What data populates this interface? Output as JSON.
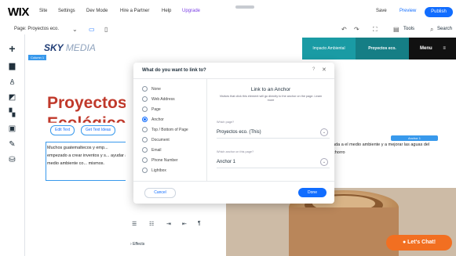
{
  "topbar": {
    "logo": "WIX",
    "menu": [
      "Site",
      "Settings",
      "Dev Mode",
      "Hire a Partner",
      "Help",
      "Upgrade"
    ],
    "save": "Save",
    "preview": "Preview",
    "publish": "Publish"
  },
  "secbar": {
    "page_label": "Page: Proyectos eco.",
    "tools_label": "Tools",
    "search_label": "Search"
  },
  "site": {
    "logo_main": "SKY",
    "logo_sub": "MEDIA",
    "nav": [
      "Impacto Ambiental",
      "Proyectos eco.",
      "Menu"
    ],
    "column_tag": "Column 1",
    "heading_line1": "Proyectos",
    "heading_line2": "Ecológicos",
    "edit_text_btn": "Edit Text",
    "edit_text_ideas_btn": "Get Text Ideas",
    "body_text": "Muchos guatemaltecos y emp... empezado a crear inventos y s... ayudar al medio ambiente co... mismos.",
    "right_text": "ada a el medio ambiente y a mejorar las aguas del chorro",
    "anchor_tag": "Anchor 1"
  },
  "inspector": {
    "effects": "Effects"
  },
  "modal": {
    "title": "What do you want to link to?",
    "options": [
      "None",
      "Web Address",
      "Page",
      "Anchor",
      "Top / Bottom of Page",
      "Document",
      "Email",
      "Phone Number",
      "Lightbox"
    ],
    "selected_index": 3,
    "anchor_heading": "Link to an Anchor",
    "anchor_desc": "Visitors that click this element will go directly to the anchor on the page. Learn more",
    "which_page_label": "Which page?",
    "which_page_value": "Proyectos eco. (This)",
    "which_anchor_label": "Which anchor on this page?",
    "which_anchor_value": "Anchor 1",
    "cancel": "Cancel",
    "done": "Done"
  },
  "chat": {
    "label": "Let's Chat!"
  },
  "colors": {
    "accent": "#116dff",
    "heading_red": "#c0392b",
    "chat_orange": "#f26f21"
  }
}
